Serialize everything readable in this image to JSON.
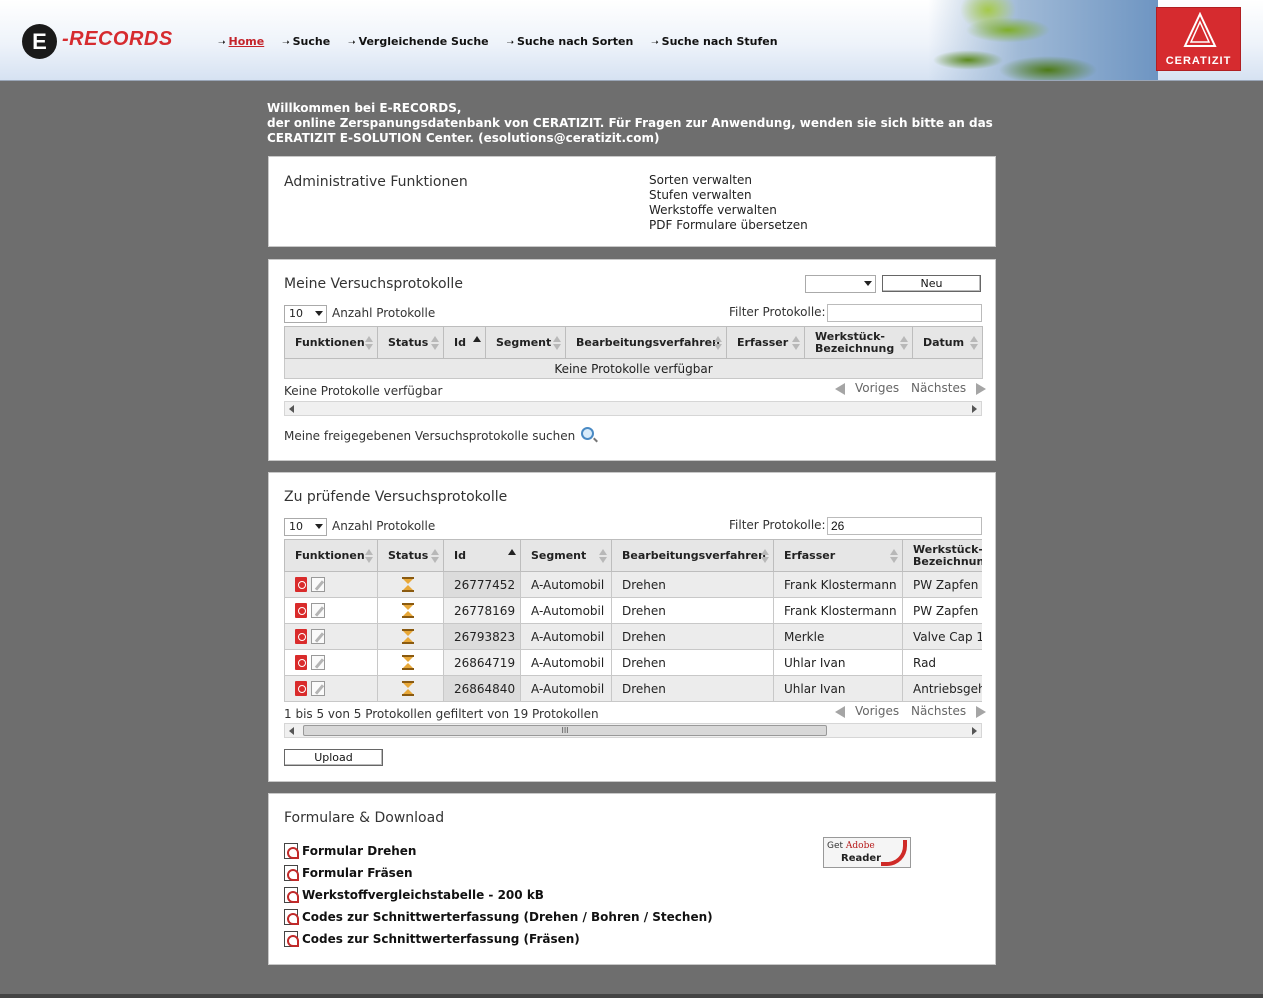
{
  "header": {
    "logo_badge": "E",
    "logo_text": "-RECORDS",
    "nav": [
      {
        "label": "Home",
        "active": true
      },
      {
        "label": "Suche",
        "active": false
      },
      {
        "label": "Vergleichende Suche",
        "active": false
      },
      {
        "label": "Suche nach Sorten",
        "active": false
      },
      {
        "label": "Suche nach Stufen",
        "active": false
      }
    ],
    "brand": "CERATIZIT",
    "brand_color": "#d62b2f"
  },
  "welcome": {
    "line1": "Willkommen bei E-RECORDS,",
    "line2": "der online Zerspanungsdatenbank von CERATIZIT. Für Fragen zur Anwendung, wenden sie sich bitte an das",
    "line3": "CERATIZIT E-SOLUTION Center. (esolutions@ceratizit.com)"
  },
  "admin": {
    "title": "Administrative Funktionen",
    "links": [
      "Sorten verwalten",
      "Stufen verwalten",
      "Werkstoffe verwalten",
      "PDF Formulare übersetzen"
    ]
  },
  "mine": {
    "title": "Meine Versuchsprotokolle",
    "type_select": "",
    "new_button": "Neu",
    "page_size": "10",
    "page_size_label": "Anzahl Protokolle",
    "filter_label": "Filter Protokolle:",
    "filter_value": "",
    "columns": [
      "Funktionen",
      "Status",
      "Id",
      "Segment",
      "Bearbeitungsverfahren",
      "Erfasser",
      "Werkstück-Bezeichnung",
      "Datum"
    ],
    "empty_text": "Keine Protokolle verfügbar",
    "info": "Keine Protokolle verfügbar",
    "prev": "Voriges",
    "next": "Nächstes",
    "search_shared": "Meine freigegebenen Versuchsprotokolle suchen"
  },
  "review": {
    "title": "Zu prüfende Versuchsprotokolle",
    "page_size": "10",
    "page_size_label": "Anzahl Protokolle",
    "filter_label": "Filter Protokolle:",
    "filter_value": "26",
    "columns": [
      "Funktionen",
      "Status",
      "Id",
      "Segment",
      "Bearbeitungsverfahren",
      "Erfasser",
      "Werkstück-Bezeichnung"
    ],
    "rows": [
      {
        "id": "26777452",
        "segment": "A-Automobil",
        "verfahren": "Drehen",
        "erfasser": "Frank Klostermann",
        "werkstueck": "PW Zapfen"
      },
      {
        "id": "26778169",
        "segment": "A-Automobil",
        "verfahren": "Drehen",
        "erfasser": "Frank Klostermann",
        "werkstueck": "PW Zapfen"
      },
      {
        "id": "26793823",
        "segment": "A-Automobil",
        "verfahren": "Drehen",
        "erfasser": "Merkle",
        "werkstueck": "Valve Cap 1"
      },
      {
        "id": "26864719",
        "segment": "A-Automobil",
        "verfahren": "Drehen",
        "erfasser": "Uhlar Ivan",
        "werkstueck": "Rad"
      },
      {
        "id": "26864840",
        "segment": "A-Automobil",
        "verfahren": "Drehen",
        "erfasser": "Uhlar Ivan",
        "werkstueck": "Antriebsgehä"
      }
    ],
    "info": "1 bis 5 von 5 Protokollen gefiltert von 19 Protokollen",
    "prev": "Voriges",
    "next": "Nächstes",
    "scroll_thumb": "III",
    "upload_button": "Upload"
  },
  "downloads": {
    "title": "Formulare & Download",
    "items": [
      "Formular Drehen",
      "Formular Fräsen",
      "Werkstoffvergleichstabelle - 200 kB",
      "Codes zur Schnittwerterfassung (Drehen / Bohren / Stechen)",
      "Codes zur Schnittwerterfassung (Fräsen)"
    ],
    "adobe_get": "Get",
    "adobe_brand": "Adobe",
    "adobe_reader": "Reader"
  }
}
